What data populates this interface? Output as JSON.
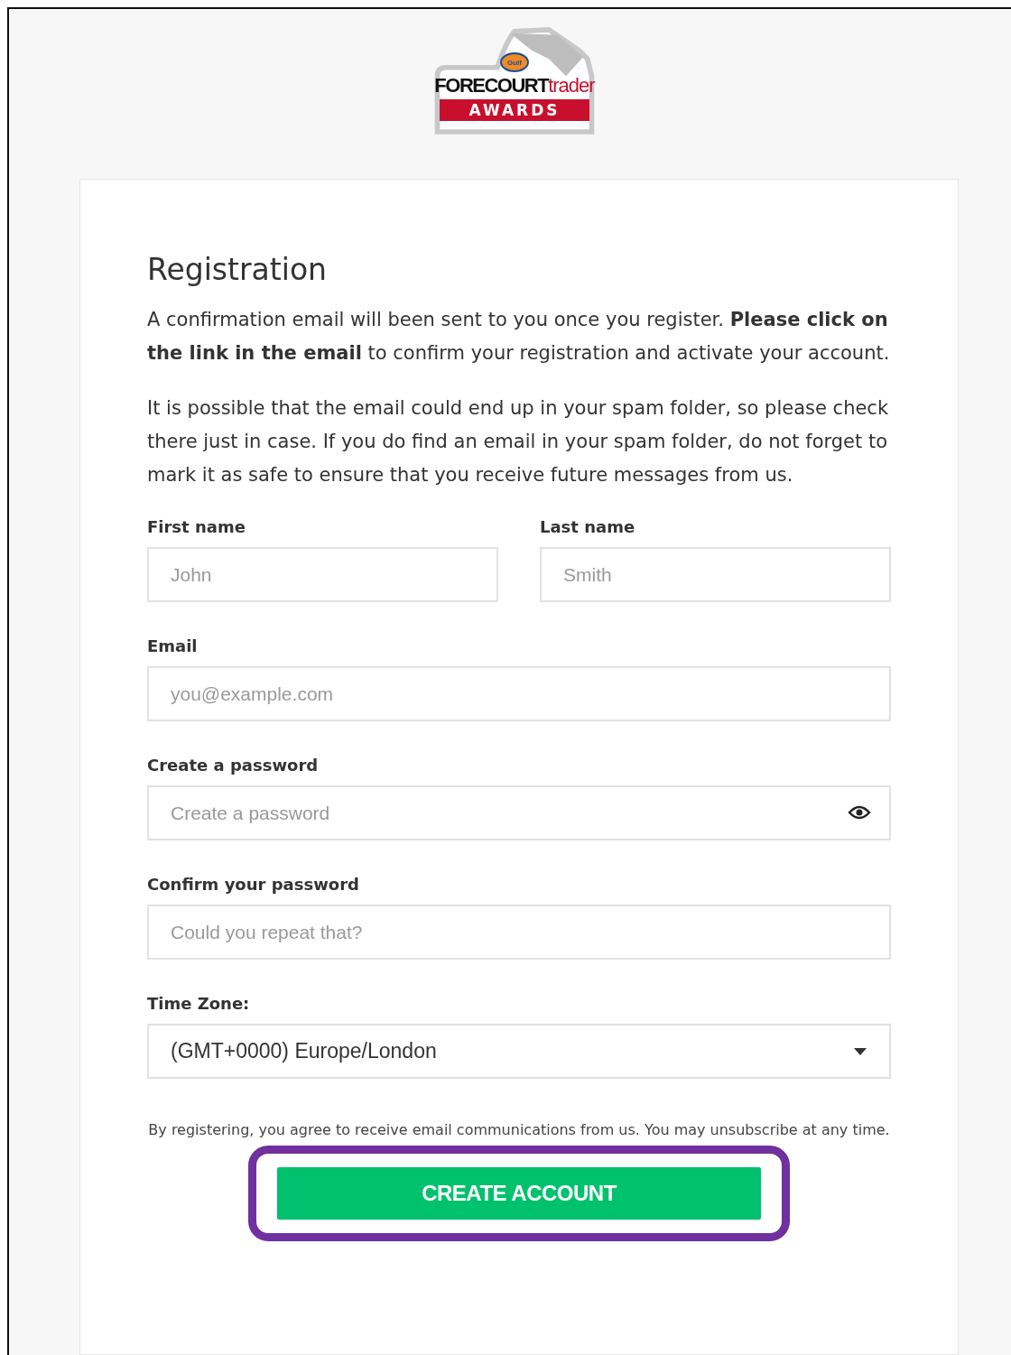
{
  "logo": {
    "badge": "Gulf",
    "brand_bold": "FORECOURT",
    "brand_light": "trader",
    "banner": "AWARDS"
  },
  "form": {
    "title": "Registration",
    "paragraphs": [
      "A confirmation email will been sent to you once you register. **Please click on the link in the email** to confirm your registration and activate your account.",
      "It is possible that the email could end up in your spam folder, so please check there just in case. If you do find an email in your spam folder, do not forget to mark it as safe to ensure that you receive future messages from us."
    ],
    "name_fields": [
      {
        "label": "First name",
        "placeholder": "John"
      },
      {
        "label": "Last name",
        "placeholder": "Smith"
      }
    ],
    "fields": [
      {
        "label": "Email",
        "placeholder": "you@example.com",
        "kind": "text"
      },
      {
        "label": "Create a password",
        "placeholder": "Create a password",
        "kind": "password"
      },
      {
        "label": "Confirm your password",
        "placeholder": "Could you repeat that?",
        "kind": "text"
      },
      {
        "label": "Time Zone:",
        "value": "(GMT+0000) Europe/London",
        "kind": "select"
      }
    ],
    "notice": "By registering, you agree to receive email communications from us. You may unsubscribe at any time.",
    "submit_button": {
      "label": "CREATE ACCOUNT",
      "highlighted": true
    }
  }
}
